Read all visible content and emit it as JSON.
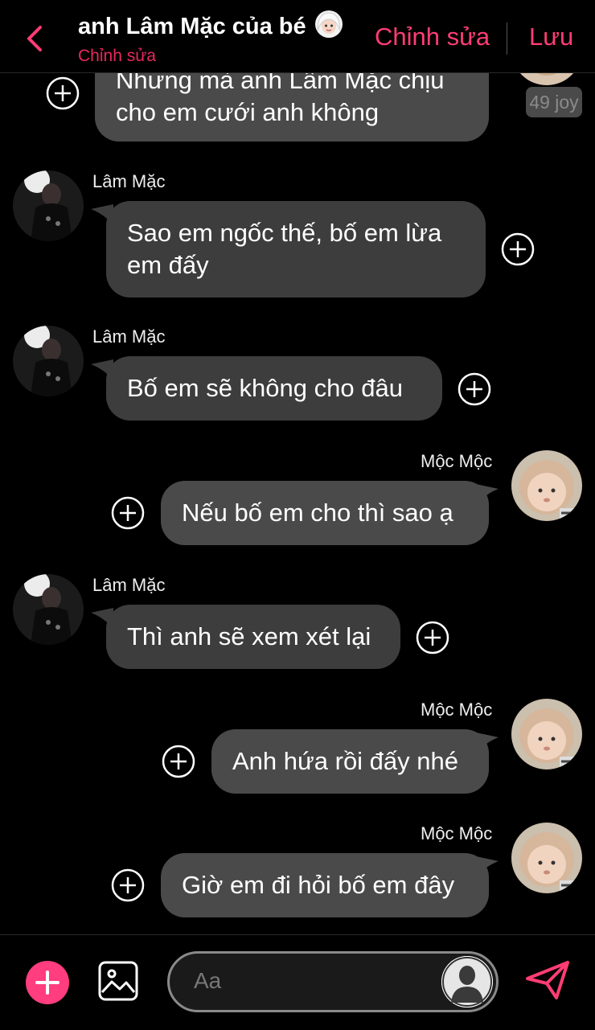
{
  "header": {
    "title": "anh Lâm Mặc của bé",
    "subtitle": "Chỉnh sửa",
    "edit_label": "Chỉnh sửa",
    "save_label": "Lưu"
  },
  "messages": {
    "m0": {
      "text_line1": "Nhưng mà anh Lâm Mặc chịu",
      "text_line2": "cho em cưới anh không",
      "badge": "49 joy"
    },
    "m1": {
      "sender": "Lâm Mặc",
      "text_line1": "Sao em ngốc thế, bố em lừa",
      "text_line2": "em đấy"
    },
    "m2": {
      "sender": "Lâm Mặc",
      "text": "Bố em sẽ không cho đâu"
    },
    "m3": {
      "sender": "Mộc Mộc",
      "text": "Nếu bố em cho thì sao ạ"
    },
    "m4": {
      "sender": "Lâm Mặc",
      "text": "Thì anh sẽ xem xét lại"
    },
    "m5": {
      "sender": "Mộc Mộc",
      "text": "Anh hứa rồi đấy nhé"
    },
    "m6": {
      "sender": "Mộc Mộc",
      "text": "Giờ em đi hỏi bố em đây"
    }
  },
  "composer": {
    "placeholder": "Aa"
  },
  "colors": {
    "accent": "#ff3d74",
    "subtitle": "#e8285c",
    "bubble_in": "#3d3d3d",
    "bubble_out": "#4a4a4a",
    "background": "#000000"
  },
  "icons": [
    "back-chevron-icon",
    "hijab-woman-emoji-icon",
    "plus-circle-icon",
    "image-gallery-icon",
    "person-silhouette-icon",
    "send-paper-plane-icon"
  ]
}
